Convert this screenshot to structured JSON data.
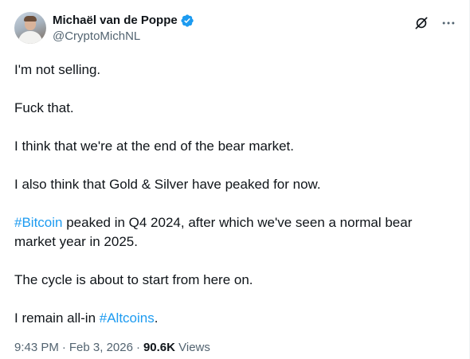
{
  "author": {
    "display_name": "Michaël van de Poppe",
    "handle": "@CryptoMichNL",
    "verified": true
  },
  "post": {
    "p1": "I'm not selling.",
    "p2": "Fuck that.",
    "p3": "I think that we're at the end of the bear market.",
    "p4": "I also think that Gold & Silver have peaked for now.",
    "p5_hashtag": "#Bitcoin",
    "p5_text": " peaked in Q4 2024, after which we've seen a normal bear market year in 2025.",
    "p6": "The cycle is about to start from here on.",
    "p7_text": "I remain all-in ",
    "p7_hashtag": "#Altcoins",
    "p7_end": "."
  },
  "meta": {
    "time": "9:43 PM",
    "dot1": "·",
    "date": "Feb 3, 2026",
    "dot2": "·",
    "views_count": "90.6K",
    "views_label": " Views"
  },
  "icons": {
    "verified": "verified-badge-icon",
    "grok": "grok-icon",
    "more": "more-icon"
  },
  "colors": {
    "accent": "#1d9bf0",
    "secondary_text": "#536471",
    "primary_text": "#0f1419"
  }
}
